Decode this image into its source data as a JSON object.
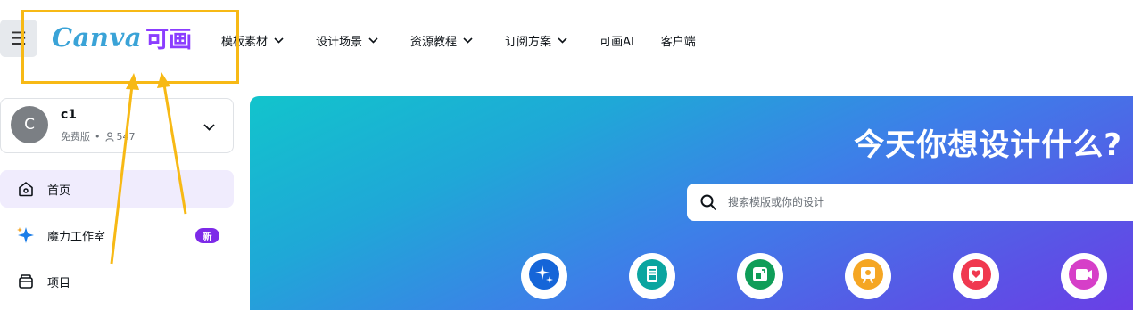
{
  "header": {
    "menu_icon": "hamburger-icon",
    "logo_word": "Canva",
    "logo_cn": "可画",
    "nav": [
      {
        "label": "模板素材",
        "has_dropdown": true
      },
      {
        "label": "设计场景",
        "has_dropdown": true
      },
      {
        "label": "资源教程",
        "has_dropdown": true
      },
      {
        "label": "订阅方案",
        "has_dropdown": true
      },
      {
        "label": "可画AI",
        "has_dropdown": false
      },
      {
        "label": "客户端",
        "has_dropdown": false
      }
    ]
  },
  "account": {
    "avatar_letter": "C",
    "name": "c1",
    "plan": "免费版",
    "separator": "•",
    "member_count": "547"
  },
  "sidebar": {
    "items": [
      {
        "label": "首页",
        "icon": "home-icon",
        "active": true
      },
      {
        "label": "魔力工作室",
        "icon": "sparkle-icon",
        "badge": "新"
      },
      {
        "label": "项目",
        "icon": "folder-icon"
      }
    ]
  },
  "hero": {
    "title": "今天你想设计什么?",
    "search_placeholder": "搜索模版或你的设计",
    "categories": [
      {
        "icon": "sparkle-icon",
        "color": "#1565d8"
      },
      {
        "icon": "document-icon",
        "color": "#0ba5a0"
      },
      {
        "icon": "resize-icon",
        "color": "#0f9d58"
      },
      {
        "icon": "presentation-icon",
        "color": "#f5a623"
      },
      {
        "icon": "heart-icon",
        "color": "#f0384f"
      },
      {
        "icon": "video-icon",
        "color": "#d63fc8"
      }
    ]
  },
  "colors": {
    "accent": "#8b3dff",
    "annotation": "#f7b915",
    "hero_start": "#12c4cc",
    "hero_end": "#6a3fe6"
  }
}
